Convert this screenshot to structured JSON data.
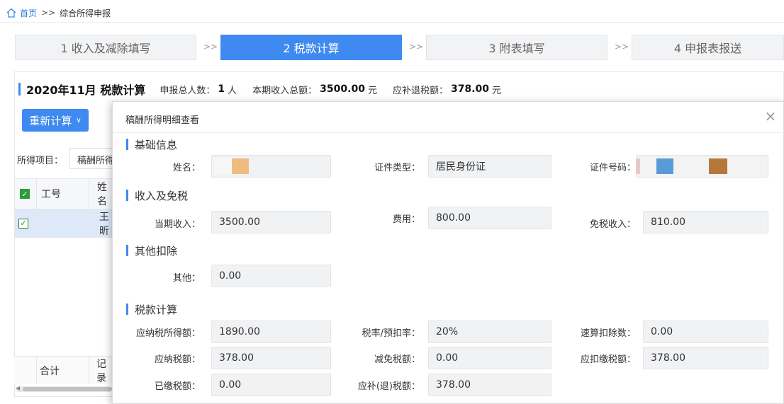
{
  "breadcrumb": {
    "home": "首页",
    "separator": ">>",
    "current": "综合所得申报"
  },
  "steps": [
    {
      "label": "1 收入及减除填写"
    },
    {
      "label": "2 税款计算"
    },
    {
      "label": "3 附表填写"
    },
    {
      "label": "4 申报表报送"
    }
  ],
  "step_arrow": ">>",
  "summary": {
    "title": "2020年11月  税款计算",
    "count_label": "申报总人数：",
    "count_value": "1",
    "count_unit": "人",
    "income_label": "本期收入总额：",
    "income_value": "3500.00",
    "income_unit": "元",
    "refund_label": "应补退税额：",
    "refund_value": "378.00",
    "refund_unit": "元"
  },
  "recalc_button": {
    "label": "重新计算"
  },
  "filter": {
    "label": "所得项目：",
    "value": "稿酬所得"
  },
  "table": {
    "col_id": "工号",
    "col_name": "姓名",
    "row_name": "王昕",
    "footer_total": "合计",
    "footer_records": "记录"
  },
  "modal": {
    "title": "稿酬所得明细查看",
    "sections": {
      "basic": "基础信息",
      "income": "收入及免税",
      "other": "其他扣除",
      "tax": "税款计算"
    },
    "fields": {
      "name_label": "姓名：",
      "name_value": "",
      "id_type_label": "证件类型：",
      "id_type_value": "居民身份证",
      "id_no_label": "证件号码：",
      "id_no_value": "",
      "income_label": "当期收入：",
      "income_value": "3500.00",
      "cost_label": "费用：",
      "cost_value": "800.00",
      "exempt_label": "免税收入：",
      "exempt_value": "810.00",
      "other_label": "其他：",
      "other_value": "0.00",
      "taxable_label": "应纳税所得额：",
      "taxable_value": "1890.00",
      "rate_label": "税率/预扣率：",
      "rate_value": "20%",
      "quick_label": "速算扣除数：",
      "quick_value": "0.00",
      "tax_payable_label": "应纳税额：",
      "tax_payable_value": "378.00",
      "reduced_label": "减免税额：",
      "reduced_value": "0.00",
      "withheld_label": "应扣缴税额：",
      "withheld_value": "378.00",
      "paid_label": "已缴税额：",
      "paid_value": "0.00",
      "refund_label": "应补(退)税额：",
      "refund_value": "378.00"
    }
  },
  "colors": {
    "primary": "#3e8af0",
    "link": "#2f7de1",
    "checkbox": "#2e9b3a"
  },
  "icons": {
    "home": "home-icon",
    "close": "close-icon",
    "chevron": "chevron-down-icon",
    "check": "check-icon"
  }
}
